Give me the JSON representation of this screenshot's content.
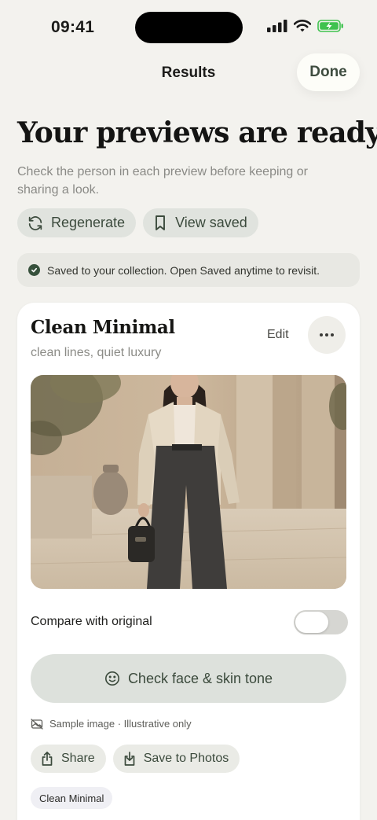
{
  "status_bar": {
    "time": "09:41"
  },
  "nav": {
    "title": "Results",
    "done_label": "Done"
  },
  "header": {
    "headline": "Your previews are ready",
    "subtitle": "Check the person in each preview before keeping or sharing a look."
  },
  "actions": {
    "regenerate_label": "Regenerate",
    "view_saved_label": "View saved"
  },
  "notice": {
    "text": "Saved to your collection. Open Saved anytime to revisit."
  },
  "card": {
    "title": "Clean Minimal",
    "subtitle": "clean lines, quiet luxury",
    "edit_label": "Edit",
    "compare_label": "Compare with original",
    "compare_on": false,
    "check_face_label": "Check face & skin tone",
    "sample_note": "Sample image · Illustrative only",
    "share_label": "Share",
    "save_photos_label": "Save to Photos",
    "tag": "Clean Minimal"
  },
  "colors": {
    "accent": "#3b4a3c",
    "background": "#f3f2ee",
    "battery": "#3fc24f"
  }
}
